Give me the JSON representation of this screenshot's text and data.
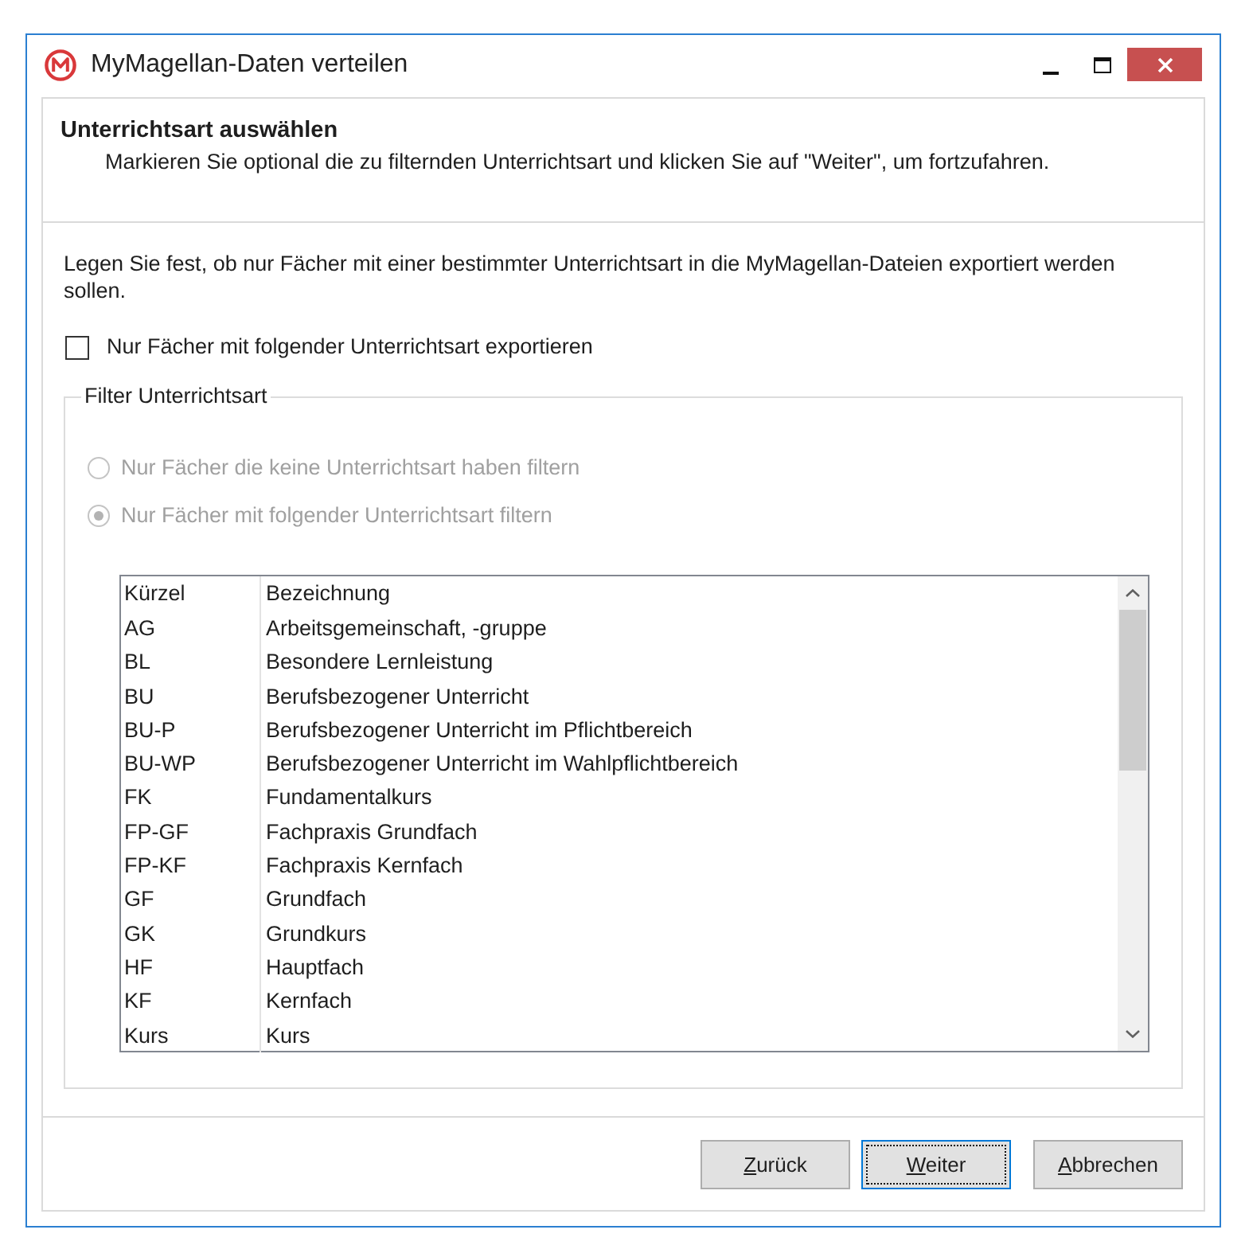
{
  "window": {
    "title": "MyMagellan-Daten verteilen"
  },
  "header": {
    "title": "Unterrichtsart auswählen",
    "description": "Markieren Sie optional die zu filternden Unterrichtsart und klicken Sie auf \"Weiter\", um fortzufahren."
  },
  "intro": "Legen Sie fest, ob nur Fächer mit einer bestimmter Unterrichtsart in die MyMagellan-Dateien exportiert werden sollen.",
  "export_option": {
    "label": "Nur Fächer mit folgender Unterrichtsart exportieren",
    "checked": false
  },
  "filter_group": {
    "title": "Filter Unterrichtsart",
    "disabled": true,
    "options": [
      {
        "label": "Nur Fächer die keine Unterrichtsart haben filtern",
        "selected": false
      },
      {
        "label": "Nur Fächer mit folgender Unterrichtsart filtern",
        "selected": true
      }
    ],
    "table": {
      "columns": [
        "Kürzel",
        "Bezeichnung"
      ],
      "rows": [
        [
          "AG",
          "Arbeitsgemeinschaft, -gruppe"
        ],
        [
          "BL",
          "Besondere Lernleistung"
        ],
        [
          "BU",
          "Berufsbezogener Unterricht"
        ],
        [
          "BU-P",
          "Berufsbezogener Unterricht im Pflichtbereich"
        ],
        [
          "BU-WP",
          "Berufsbezogener Unterricht im Wahlpflichtbereich"
        ],
        [
          "FK",
          "Fundamentalkurs"
        ],
        [
          "FP-GF",
          "Fachpraxis Grundfach"
        ],
        [
          "FP-KF",
          "Fachpraxis Kernfach"
        ],
        [
          "GF",
          "Grundfach"
        ],
        [
          "GK",
          "Grundkurs"
        ],
        [
          "HF",
          "Hauptfach"
        ],
        [
          "KF",
          "Kernfach"
        ],
        [
          "Kurs",
          "Kurs"
        ]
      ]
    }
  },
  "buttons": [
    {
      "label": "Zurück",
      "shortcut_underlined": true,
      "focused": false
    },
    {
      "label": "Weiter",
      "shortcut_underlined": true,
      "focused": true
    },
    {
      "label": "Abbrechen",
      "shortcut_underlined": true,
      "focused": false
    }
  ]
}
